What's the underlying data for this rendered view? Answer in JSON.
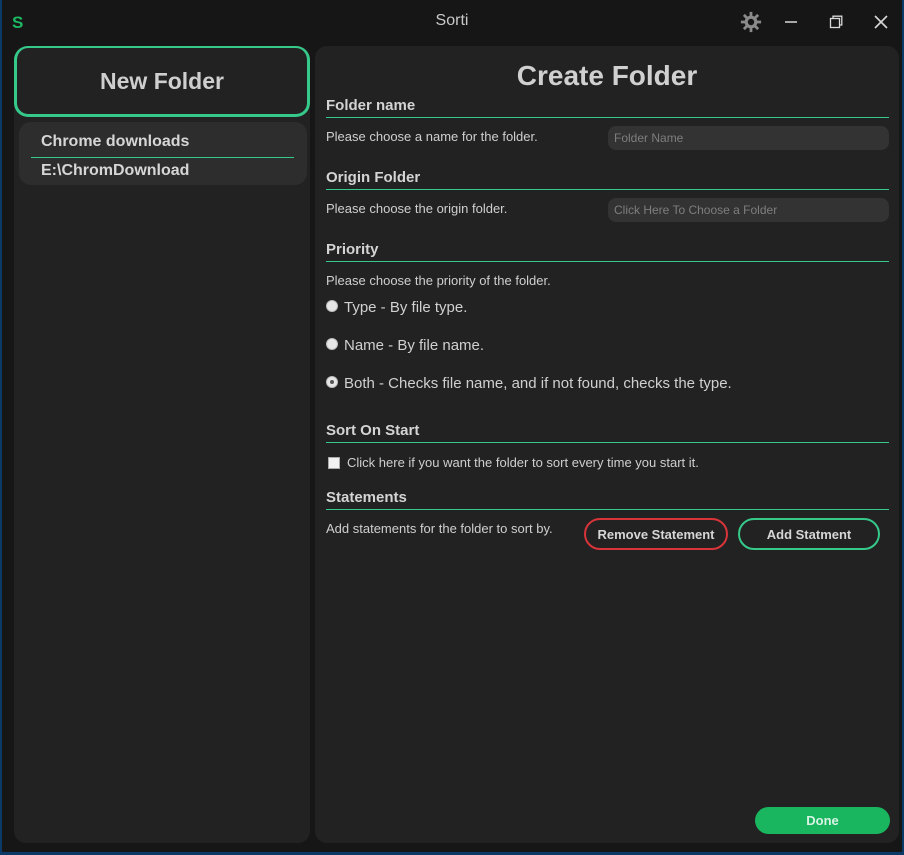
{
  "app": {
    "logo": "S",
    "title": "Sorti"
  },
  "titlebar": {
    "icons": [
      "gear-icon",
      "minimize-icon",
      "restore-icon",
      "close-icon"
    ]
  },
  "sidebar": {
    "new_folder_label": "New Folder",
    "folders": [
      {
        "name": "Chrome downloads",
        "path": "E:\\ChromDownload"
      }
    ]
  },
  "main": {
    "title": "Create Folder",
    "folder_name": {
      "heading": "Folder name",
      "desc": "Please choose a name for the folder.",
      "placeholder": "Folder Name"
    },
    "origin": {
      "heading": "Origin Folder",
      "desc": "Please choose the origin folder.",
      "placeholder": "Click Here To Choose a Folder"
    },
    "priority": {
      "heading": "Priority",
      "desc": "Please choose the priority of the folder.",
      "options": [
        {
          "label": "Type - By file type.",
          "selected": false
        },
        {
          "label": "Name - By file name.",
          "selected": false
        },
        {
          "label": "Both - Checks file name, and if not found, checks the type.",
          "selected": true
        }
      ]
    },
    "sort_on_start": {
      "heading": "Sort On Start",
      "checkbox_label": "Click here if you want the folder to sort every time you start it.",
      "checked": false
    },
    "statements": {
      "heading": "Statements",
      "desc": "Add statements for the folder to sort by.",
      "remove_label": "Remove Statement",
      "add_label": "Add Statment"
    },
    "done_label": "Done"
  },
  "colors": {
    "accent": "#35c98a",
    "danger": "#d8343a",
    "done": "#19b65f",
    "panel": "#222222",
    "window": "#161616"
  }
}
